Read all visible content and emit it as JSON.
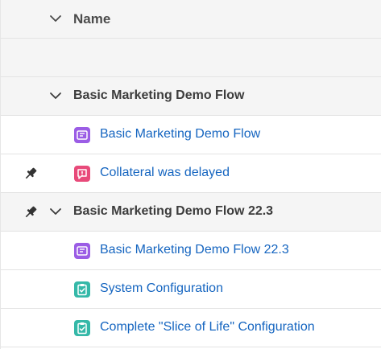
{
  "header": {
    "column_label": "Name",
    "icon": "chevron-down-icon"
  },
  "rows": [
    {
      "kind": "blank"
    },
    {
      "kind": "group",
      "label": "Basic Marketing Demo Flow",
      "pinned": false
    },
    {
      "kind": "item",
      "label": "Basic Marketing Demo Flow",
      "icon": "flow-icon",
      "icon_color": "#9b5de5",
      "pinned": false
    },
    {
      "kind": "item",
      "label": "Collateral was delayed",
      "icon": "issue-icon",
      "icon_color": "#e84a7a",
      "pinned": true
    },
    {
      "kind": "group",
      "label": "Basic Marketing Demo Flow 22.3",
      "pinned": true
    },
    {
      "kind": "item",
      "label": "Basic Marketing Demo Flow 22.3",
      "icon": "flow-icon",
      "icon_color": "#9b5de5",
      "pinned": false
    },
    {
      "kind": "item",
      "label": "System Configuration",
      "icon": "task-icon",
      "icon_color": "#35b8a8",
      "pinned": false
    },
    {
      "kind": "item",
      "label": "Complete \"Slice of Life\" Configuration",
      "icon": "task-icon",
      "icon_color": "#35b8a8",
      "pinned": false
    }
  ]
}
